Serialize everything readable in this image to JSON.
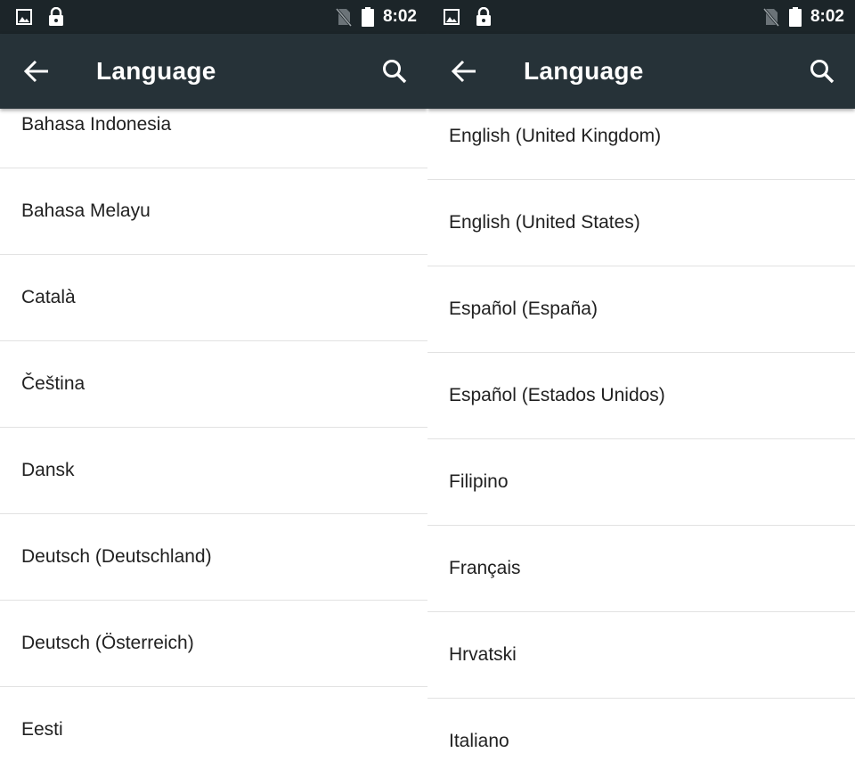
{
  "status_bar": {
    "time": "8:02"
  },
  "app_bar": {
    "title": "Language"
  },
  "left_list": [
    "Bahasa Indonesia",
    "Bahasa Melayu",
    "Català",
    "Čeština",
    "Dansk",
    "Deutsch (Deutschland)",
    "Deutsch (Österreich)",
    "Eesti"
  ],
  "right_list": [
    "English (United Kingdom)",
    "English (United States)",
    "Español (España)",
    "Español (Estados Unidos)",
    "Filipino",
    "Français",
    "Hrvatski",
    "Italiano"
  ],
  "icons": {
    "status_left": [
      "image-icon",
      "lock-icon"
    ],
    "status_right": [
      "no-sim-icon",
      "battery-icon"
    ],
    "app_bar": [
      "back-arrow-icon",
      "search-icon"
    ]
  },
  "colors": {
    "status_bar": "#1c2529",
    "app_bar": "#263238",
    "divider": "#e2e2e2",
    "text": "#212121"
  }
}
